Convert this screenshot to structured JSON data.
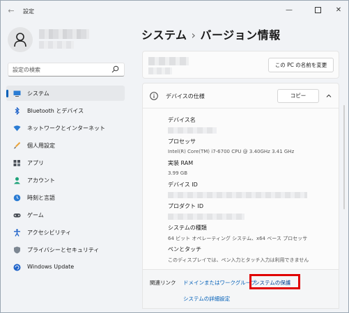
{
  "window": {
    "title": "設定",
    "back_icon": "back-arrow-icon",
    "controls": [
      "minimize-icon",
      "maximize-icon",
      "close-icon"
    ]
  },
  "search": {
    "placeholder": "設定の検索",
    "icon": "search-icon"
  },
  "sidebar": {
    "items": [
      {
        "label": "システム",
        "icon": "monitor-icon",
        "active": true
      },
      {
        "label": "Bluetooth とデバイス",
        "icon": "bluetooth-icon"
      },
      {
        "label": "ネットワークとインターネット",
        "icon": "wifi-icon"
      },
      {
        "label": "個人用設定",
        "icon": "brush-icon"
      },
      {
        "label": "アプリ",
        "icon": "apps-icon"
      },
      {
        "label": "アカウント",
        "icon": "person-icon"
      },
      {
        "label": "時刻と言語",
        "icon": "globe-clock-icon"
      },
      {
        "label": "ゲーム",
        "icon": "gamepad-icon"
      },
      {
        "label": "アクセシビリティ",
        "icon": "accessibility-icon"
      },
      {
        "label": "プライバシーとセキュリティ",
        "icon": "shield-icon"
      },
      {
        "label": "Windows Update",
        "icon": "update-icon"
      }
    ]
  },
  "main": {
    "breadcrumb_parent": "システム",
    "breadcrumb_separator": "›",
    "page_title": "バージョン情報",
    "rename_button": "この PC の名前を変更",
    "device_spec": {
      "title": "デバイスの仕様",
      "copy_button": "コピー",
      "fields": [
        {
          "label": "デバイス名",
          "value": ""
        },
        {
          "label": "プロセッサ",
          "value": "Intel(R) Core(TM) i7-6700 CPU @ 3.40GHz   3.41 GHz"
        },
        {
          "label": "実装 RAM",
          "value": "3.99 GB"
        },
        {
          "label": "デバイス ID",
          "value": ""
        },
        {
          "label": "プロダクト ID",
          "value": ""
        },
        {
          "label": "システムの種類",
          "value": "64 ビット オペレーティング システム、x64 ベース プロセッサ"
        },
        {
          "label": "ペンとタッチ",
          "value": "このディスプレイでは、ペン入力とタッチ入力は利用できません"
        }
      ]
    },
    "related_links": {
      "label": "関連リンク",
      "links": [
        "ドメインまたはワークグループ",
        "システムの保護",
        "システムの詳細設定"
      ]
    }
  },
  "colors": {
    "accent": "#005fb8",
    "highlight_box": "#e00000",
    "background": "#f1f3f6"
  }
}
